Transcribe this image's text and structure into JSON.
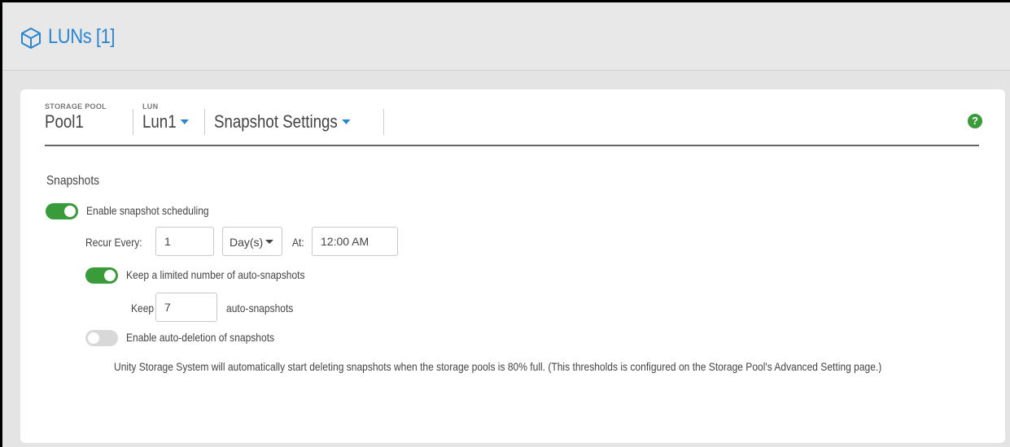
{
  "header": {
    "title": "LUNs [1]",
    "icon": "cube-icon",
    "title_color": "#2a86d1"
  },
  "breadcrumb": {
    "storage_pool_label": "STORAGE POOL",
    "storage_pool_value": "Pool1",
    "lun_label": "LUN",
    "lun_value": "Lun1",
    "view_value": "Snapshot Settings"
  },
  "help": {
    "icon": "help-icon",
    "glyph": "?"
  },
  "snapshots": {
    "section_title": "Snapshots",
    "enable_scheduling_label": "Enable snapshot scheduling",
    "enable_scheduling_on": true,
    "recur_every_label": "Recur Every:",
    "recur_every_value": "1",
    "recur_unit": "Day(s)",
    "at_label": "At:",
    "at_value": "12:00 AM",
    "keep_limited_label": "Keep a limited number of auto-snapshots",
    "keep_limited_on": true,
    "keep_label": "Keep",
    "keep_value": "7",
    "keep_suffix": "auto-snapshots",
    "auto_delete_label": "Enable auto-deletion of snapshots",
    "auto_delete_on": false,
    "auto_delete_description": "Unity Storage System will automatically start deleting snapshots when the storage pools is 80% full. (This thresholds is configured on the Storage Pool's Advanced Setting page.)"
  },
  "colors": {
    "accent": "#2a86d1",
    "toggle_on": "#3a9b3a",
    "toggle_off": "#d8d8d8"
  }
}
